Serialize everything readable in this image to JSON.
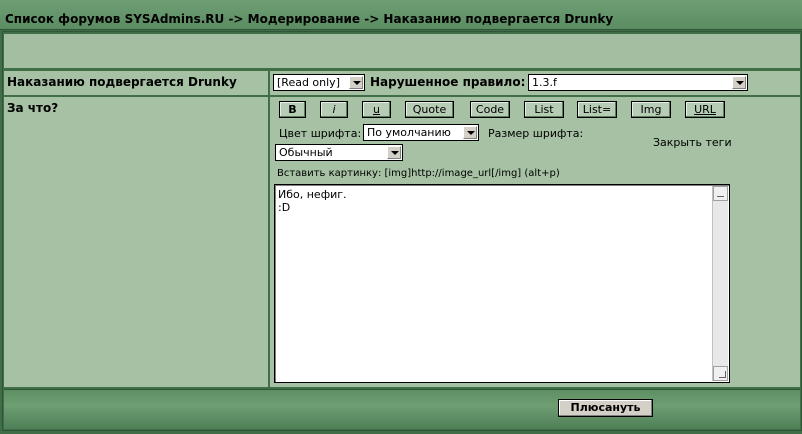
{
  "title": "Список форумов SYSAdmins.RU -> Модерирование -> Наказанию подвергается Drunky",
  "punish_row": {
    "label": "Наказанию подвергается Drunky",
    "mode_select": "[Read only]",
    "rule_label": "Нарушенное правило:",
    "rule_select": "1.3.f"
  },
  "reason_row": {
    "label": "За что?"
  },
  "toolbar": {
    "buttons": [
      "B",
      "i",
      "u",
      "Quote",
      "Code",
      "List",
      "List=",
      "Img",
      "URL"
    ]
  },
  "font_color": {
    "label": "Цвет шрифта:",
    "value": "По умолчанию"
  },
  "font_size": {
    "label": "Размер шрифта:",
    "value": "Обычный"
  },
  "close_tags": "Закрыть теги",
  "insert_hint": "Вставить картинку: [img]http://image_url[/img]  (alt+p)",
  "message": "Ибо, нефиг.\n:D",
  "submit_label": "Плюсануть"
}
